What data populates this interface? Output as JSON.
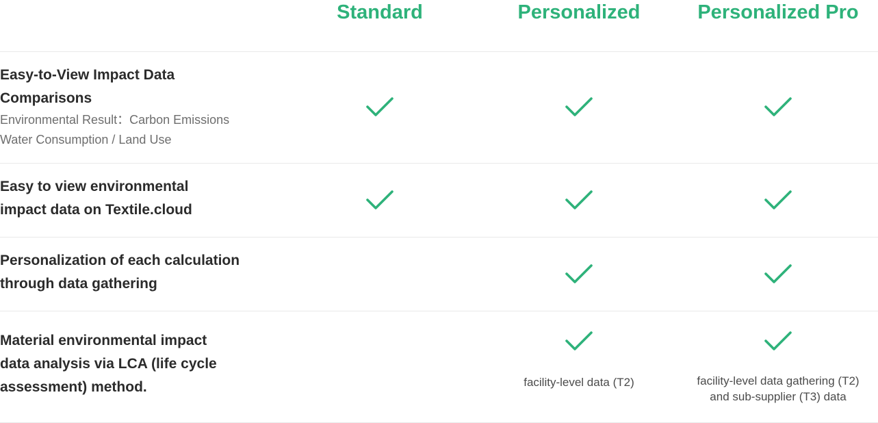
{
  "plans": {
    "standard": "Standard",
    "personalized": "Personalized",
    "personalized_pro": "Personalized Pro"
  },
  "features": [
    {
      "title_line1": "Easy-to-View Impact Data",
      "title_line2": "Comparisons",
      "desc_line1": "Environmental Result：Carbon Emissions",
      "desc_line2": "Water Consumption / Land Use",
      "standard": true,
      "personalized": true,
      "personalized_pro": true
    },
    {
      "title_line1": "Easy to view environmental",
      "title_line2": "impact data on Textile.cloud",
      "standard": true,
      "personalized": true,
      "personalized_pro": true
    },
    {
      "title_line1": "Personalization of each calculation",
      "title_line2": "through data gathering",
      "standard": false,
      "personalized": true,
      "personalized_pro": true
    },
    {
      "title_line1": "Material environmental impact",
      "title_line2": "data analysis via LCA (life cycle",
      "title_line3": "assessment) method.",
      "standard": false,
      "personalized": true,
      "personalized_pro": true,
      "personalized_note": "facility-level data (T2)",
      "personalized_pro_note_line1": "facility-level data gathering (T2)",
      "personalized_pro_note_line2": "and sub-supplier (T3) data"
    }
  ],
  "icons": {
    "check": "check-icon"
  },
  "colors": {
    "accent": "#2eb27a",
    "text": "#2b2b2b",
    "muted": "#6e6e6e",
    "divider": "#e9e9e9"
  }
}
